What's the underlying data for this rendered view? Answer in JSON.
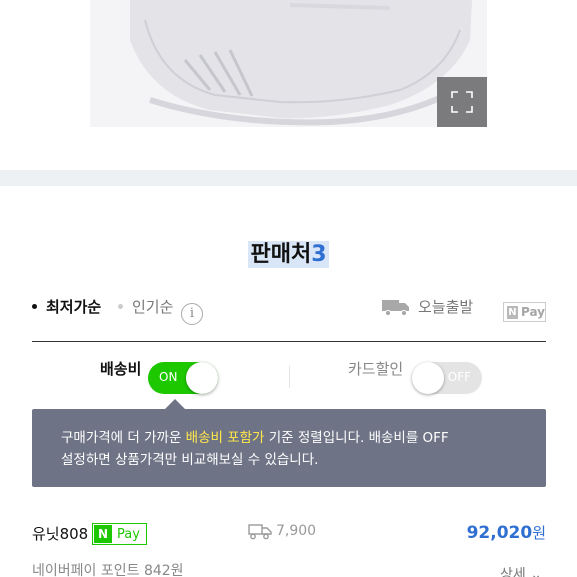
{
  "image_viewer": {
    "expand_icon": "fullscreen-expand-icon"
  },
  "sellers": {
    "title": "판매처",
    "count": "3"
  },
  "sort": {
    "lowest": "최저가순",
    "popular": "인기순",
    "info_icon_label": "i",
    "today_shipping": "오늘출발",
    "npay_filter": {
      "n": "N",
      "pay": "Pay"
    }
  },
  "filters": {
    "shipping_label": "배송비",
    "shipping_toggle": "ON",
    "card_label": "카드할인",
    "card_toggle": "OFF"
  },
  "tooltip": {
    "line1_before": "구매가격에 더 가까운 ",
    "line1_highlight": "배송비 포함가",
    "line1_after": " 기준 정렬입니다. 배송비를 OFF",
    "line2": "설정하면 상품가격만 비교해보실 수 있습니다."
  },
  "offers": [
    {
      "seller": "유닛808",
      "npay": {
        "n": "N",
        "pay": "Pay"
      },
      "shipping_fee": "7,900",
      "price": "92,020",
      "currency": "원",
      "points": "네이버페이 포인트 842원",
      "detail": "상세 ⌄"
    }
  ],
  "colors": {
    "accent_blue": "#2f6fd1",
    "naver_green": "#1ec800",
    "tooltip_bg": "#6f7386",
    "tooltip_highlight": "#ffe94a"
  }
}
